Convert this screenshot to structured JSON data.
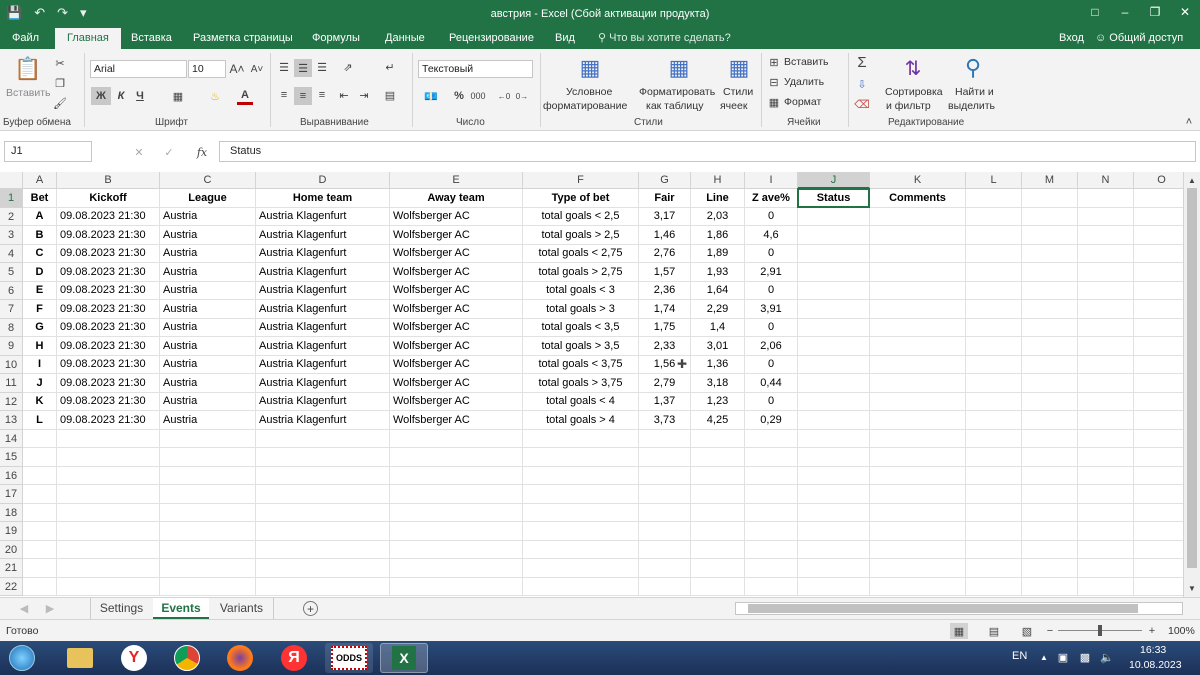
{
  "window": {
    "title": "австрия - Excel (Сбой активации продукта)",
    "controls": [
      "□",
      "–",
      "❐",
      "✕"
    ]
  },
  "menu": {
    "tabs": [
      "Файл",
      "Главная",
      "Вставка",
      "Разметка страницы",
      "Формулы",
      "Данные",
      "Рецензирование",
      "Вид"
    ],
    "active_tab": "Главная",
    "tell_me": "Что вы хотите сделать?",
    "signin": "Вход",
    "share": "Общий доступ"
  },
  "ribbon": {
    "clipboard": {
      "paste": "Вставить",
      "label": "Буфер обмена"
    },
    "font": {
      "name": "Arial",
      "size": "10",
      "bold": "Ж",
      "italic": "К",
      "underline": "Ч",
      "label": "Шрифт"
    },
    "alignment": {
      "label": "Выравнивание"
    },
    "number": {
      "format": "Текстовый",
      "percent": "%",
      "thousands": "000",
      "label": "Число"
    },
    "styles": {
      "conditional": [
        "Условное",
        "форматирование"
      ],
      "format_table": [
        "Форматировать",
        "как таблицу"
      ],
      "cell_styles": [
        "Стили",
        "ячеек"
      ],
      "label": "Стили"
    },
    "cells": {
      "insert": "Вставить",
      "delete": "Удалить",
      "format": "Формат",
      "label": "Ячейки"
    },
    "editing": {
      "sort": [
        "Сортировка",
        "и фильтр"
      ],
      "find": [
        "Найти и",
        "выделить"
      ],
      "label": "Редактирование"
    }
  },
  "formula_bar": {
    "name_box": "J1",
    "fx": "fx",
    "content": "Status"
  },
  "sheet": {
    "columns": [
      "A",
      "B",
      "C",
      "D",
      "E",
      "F",
      "G",
      "H",
      "I",
      "J",
      "K",
      "L",
      "M",
      "N",
      "O"
    ],
    "selected_column": "J",
    "selected_row": 1,
    "rows": [
      [
        "Bet",
        "Kickoff",
        "League",
        "Home team",
        "Away team",
        "Type of bet",
        "Fair",
        "Line",
        "Z ave%",
        "Status",
        "Comments"
      ],
      [
        "A",
        "09.08.2023 21:30",
        "Austria",
        "Austria Klagenfurt",
        "Wolfsberger AC",
        "total goals < 2,5",
        "3,17",
        "2,03",
        "0",
        "",
        ""
      ],
      [
        "B",
        "09.08.2023 21:30",
        "Austria",
        "Austria Klagenfurt",
        "Wolfsberger AC",
        "total goals > 2,5",
        "1,46",
        "1,86",
        "4,6",
        "",
        ""
      ],
      [
        "C",
        "09.08.2023 21:30",
        "Austria",
        "Austria Klagenfurt",
        "Wolfsberger AC",
        "total goals < 2,75",
        "2,76",
        "1,89",
        "0",
        "",
        ""
      ],
      [
        "D",
        "09.08.2023 21:30",
        "Austria",
        "Austria Klagenfurt",
        "Wolfsberger AC",
        "total goals > 2,75",
        "1,57",
        "1,93",
        "2,91",
        "",
        ""
      ],
      [
        "E",
        "09.08.2023 21:30",
        "Austria",
        "Austria Klagenfurt",
        "Wolfsberger AC",
        "total goals < 3",
        "2,36",
        "1,64",
        "0",
        "",
        ""
      ],
      [
        "F",
        "09.08.2023 21:30",
        "Austria",
        "Austria Klagenfurt",
        "Wolfsberger AC",
        "total goals > 3",
        "1,74",
        "2,29",
        "3,91",
        "",
        ""
      ],
      [
        "G",
        "09.08.2023 21:30",
        "Austria",
        "Austria Klagenfurt",
        "Wolfsberger AC",
        "total goals < 3,5",
        "1,75",
        "1,4",
        "0",
        "",
        ""
      ],
      [
        "H",
        "09.08.2023 21:30",
        "Austria",
        "Austria Klagenfurt",
        "Wolfsberger AC",
        "total goals > 3,5",
        "2,33",
        "3,01",
        "2,06",
        "",
        ""
      ],
      [
        "I",
        "09.08.2023 21:30",
        "Austria",
        "Austria Klagenfurt",
        "Wolfsberger AC",
        "total goals < 3,75",
        "1,56",
        "1,36",
        "0",
        "",
        ""
      ],
      [
        "J",
        "09.08.2023 21:30",
        "Austria",
        "Austria Klagenfurt",
        "Wolfsberger AC",
        "total goals > 3,75",
        "2,79",
        "3,18",
        "0,44",
        "",
        ""
      ],
      [
        "K",
        "09.08.2023 21:30",
        "Austria",
        "Austria Klagenfurt",
        "Wolfsberger AC",
        "total goals < 4",
        "1,37",
        "1,23",
        "0",
        "",
        ""
      ],
      [
        "L",
        "09.08.2023 21:30",
        "Austria",
        "Austria Klagenfurt",
        "Wolfsberger AC",
        "total goals > 4",
        "3,73",
        "4,25",
        "0,29",
        "",
        ""
      ]
    ],
    "total_rows": 22
  },
  "sheet_tabs": [
    "Settings",
    "Events",
    "Variants"
  ],
  "active_sheet": "Events",
  "status": {
    "text": "Готово",
    "zoom": "100%"
  },
  "taskbar": {
    "lang": "EN",
    "time": "16:33",
    "date": "10.08.2023",
    "odds_label": "ODDS"
  },
  "colors": {
    "accent": "#217346",
    "taskbar": "#1b3157"
  }
}
